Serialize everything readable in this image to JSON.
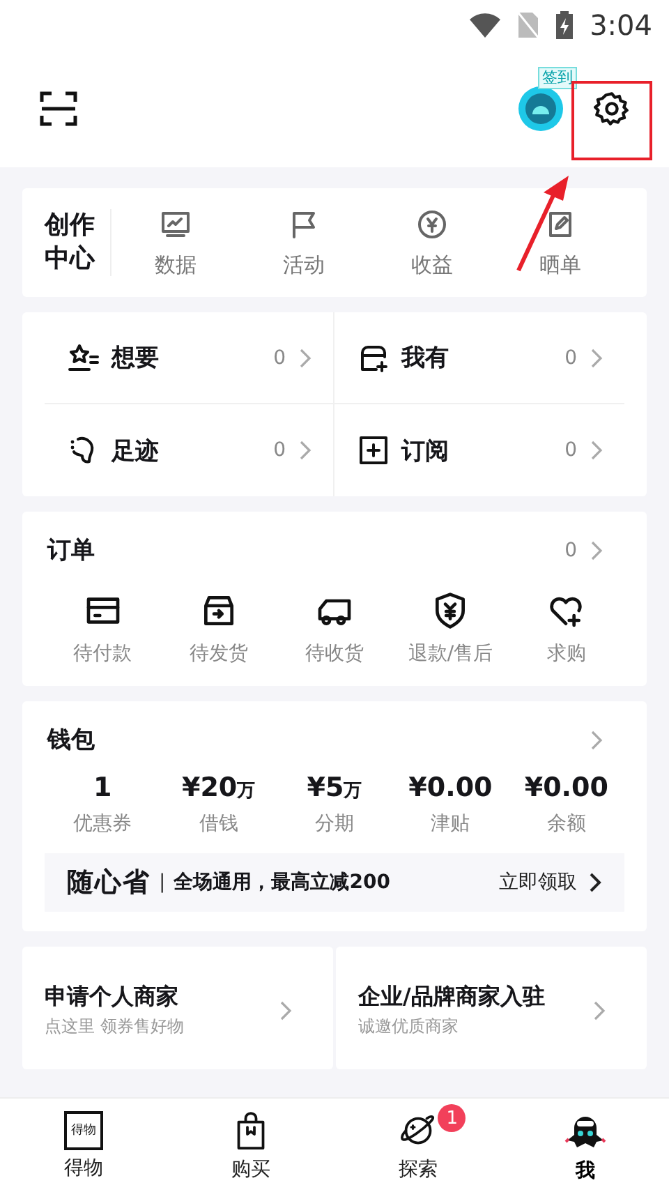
{
  "status_bar": {
    "time": "3:04"
  },
  "header": {
    "checkin_badge": "签到"
  },
  "creator": {
    "title": "创作中心",
    "items": [
      {
        "kind": "data",
        "label": "数据"
      },
      {
        "kind": "activity",
        "label": "活动"
      },
      {
        "kind": "income",
        "label": "收益"
      },
      {
        "kind": "showcase",
        "label": "晒单"
      }
    ]
  },
  "collections": [
    {
      "kind": "want",
      "label": "想要",
      "count": "0"
    },
    {
      "kind": "own",
      "label": "我有",
      "count": "0"
    },
    {
      "kind": "footprint",
      "label": "足迹",
      "count": "0"
    },
    {
      "kind": "subscribe",
      "label": "订阅",
      "count": "0"
    }
  ],
  "orders": {
    "title": "订单",
    "count": "0",
    "items": [
      {
        "kind": "pay",
        "label": "待付款"
      },
      {
        "kind": "ship",
        "label": "待发货"
      },
      {
        "kind": "receive",
        "label": "待收货"
      },
      {
        "kind": "refund",
        "label": "退款/售后"
      },
      {
        "kind": "wish",
        "label": "求购"
      }
    ]
  },
  "wallet": {
    "title": "钱包",
    "items": [
      {
        "value": "1",
        "label": "优惠券"
      },
      {
        "value": "¥20",
        "unit": "万",
        "label": "借钱"
      },
      {
        "value": "¥5",
        "unit": "万",
        "label": "分期"
      },
      {
        "value": "¥0.00",
        "label": "津贴"
      },
      {
        "value": "¥0.00",
        "label": "余额"
      }
    ],
    "promo": {
      "brand": "随心省",
      "separator": "|",
      "text": "全场通用，最高立减200",
      "action": "立即领取"
    }
  },
  "merchants": [
    {
      "title": "申请个人商家",
      "subtitle": "点这里 领券售好物"
    },
    {
      "title": "企业/品牌商家入驻",
      "subtitle": "诚邀优质商家"
    }
  ],
  "tabs": [
    {
      "kind": "home",
      "label": "得物",
      "logo_text": "得物",
      "selected": false
    },
    {
      "kind": "buy",
      "label": "购买",
      "selected": false
    },
    {
      "kind": "explore",
      "label": "探索",
      "badge": "1",
      "selected": false
    },
    {
      "kind": "me",
      "label": "我",
      "selected": true
    }
  ]
}
